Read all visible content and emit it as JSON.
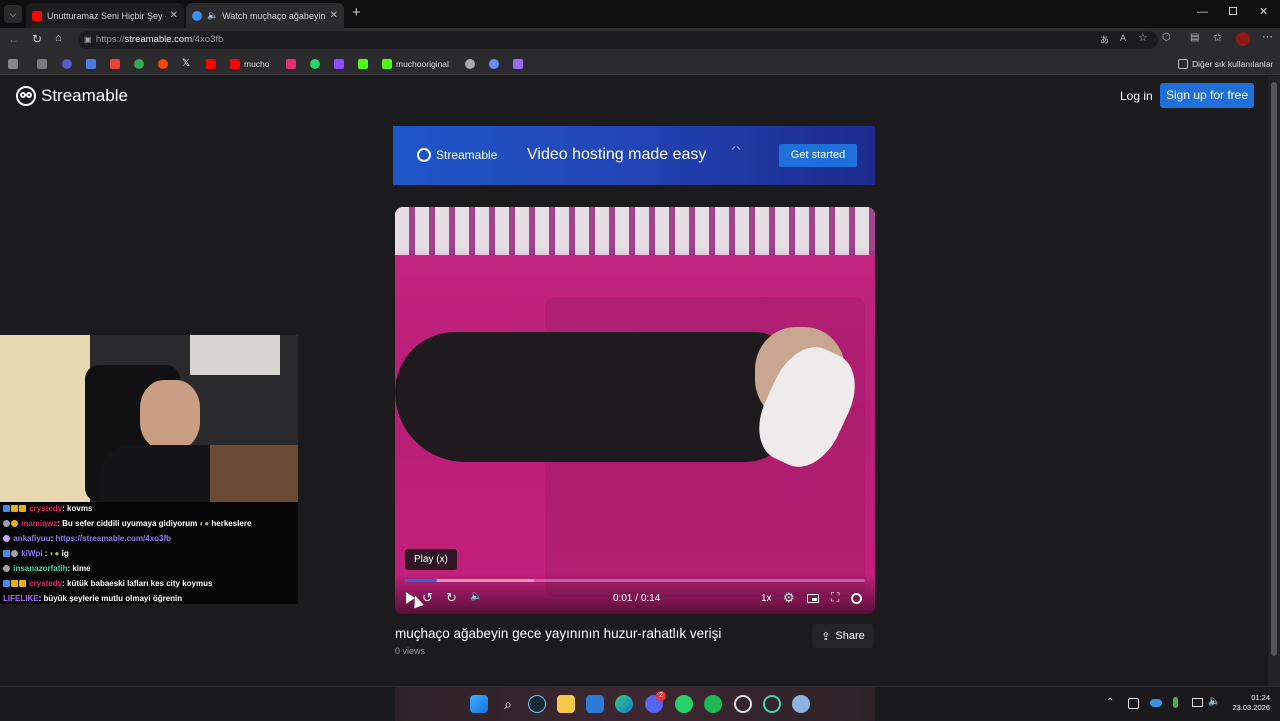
{
  "browser": {
    "tabs": [
      {
        "title": "Unutturamaz Seni Hiçbir Şey - You",
        "active": false
      },
      {
        "title": "Watch muçhaço ağabeyin gec",
        "active": true
      }
    ],
    "new_tab": "+",
    "window_controls": [
      "minimize",
      "restore",
      "close"
    ],
    "url_prefix": "https://",
    "url_host": "streamable.com",
    "url_path": "/4xo3fb",
    "bookmarks": [
      {
        "label": "",
        "icon": "grid-icon",
        "color": "#888888"
      },
      {
        "label": "",
        "icon": "reddit-icon",
        "color": "#ff4500"
      },
      {
        "label": "",
        "icon": "gmail-icon",
        "color": "#ea4335"
      },
      {
        "label": "",
        "icon": "chrome-icon",
        "color": "#34a853"
      },
      {
        "label": "",
        "icon": "x-icon",
        "color": "#ffffff"
      },
      {
        "label": "",
        "icon": "youtube-icon",
        "color": "#ff0000"
      },
      {
        "label": "mucho",
        "icon": "youtube-icon",
        "color": "#ff0000"
      },
      {
        "label": "",
        "icon": "instagram-icon",
        "color": "#e1306c"
      },
      {
        "label": "",
        "icon": "whatsapp-icon",
        "color": "#25d366"
      },
      {
        "label": "",
        "icon": "twitch-icon",
        "color": "#9146ff"
      },
      {
        "label": "",
        "icon": "kick-icon",
        "color": "#53fc18"
      },
      {
        "label": "muchooriginal",
        "icon": "kick-icon",
        "color": "#53fc18"
      }
    ],
    "other_bookmarks": "Diğer sık kullanılanlar"
  },
  "site": {
    "logo_text": "Streamable",
    "login_label": "Log in",
    "signup_label": "Sign up for free"
  },
  "banner": {
    "logo_text": "Streamable",
    "tagline": "Video hosting made easy",
    "cta_label": "Get started"
  },
  "player": {
    "tooltip": "Play (x)",
    "time_current": "0:01",
    "time_sep": " / ",
    "time_total": "0:14",
    "speed_label": "1x",
    "progress": 0.07,
    "buffered": 0.28
  },
  "video_info": {
    "title": "muçhaço ağabeyin gece yayınının huzur-rahatlık verişi",
    "views": "0 views",
    "share_label": "Share"
  },
  "chat": [
    {
      "user": "crystedy",
      "user_color": "#e0245e",
      "text": ": kovms"
    },
    {
      "user": "mamiqwz",
      "user_color": "#e0245e",
      "text": ": Bu sefer ciddili uyumaya gidiyorum",
      "extra": "herkeslere"
    },
    {
      "user": "ankafiyuu",
      "user_color": "#8a7cf0",
      "text": ": ",
      "link": "https://streamable.com/4xo3fb"
    },
    {
      "user": "kiWpi",
      "user_color": "#8a7cf0",
      "text": " :",
      "extra": "ig"
    },
    {
      "user": "insanazorfatih",
      "user_color": "#3fd8a8",
      "text": ": kime"
    },
    {
      "user": "crystedy",
      "user_color": "#e0245e",
      "text": ": kütük babaeski lafları kes city koymus"
    },
    {
      "user": "LIFELIKE",
      "user_color": "#b065ff",
      "text": ": büyük şeylerle mutlu olmayi öğrenin"
    }
  ],
  "taskbar": {
    "time": "01:24",
    "date": "23.03.2026",
    "discord_badge": "2"
  }
}
